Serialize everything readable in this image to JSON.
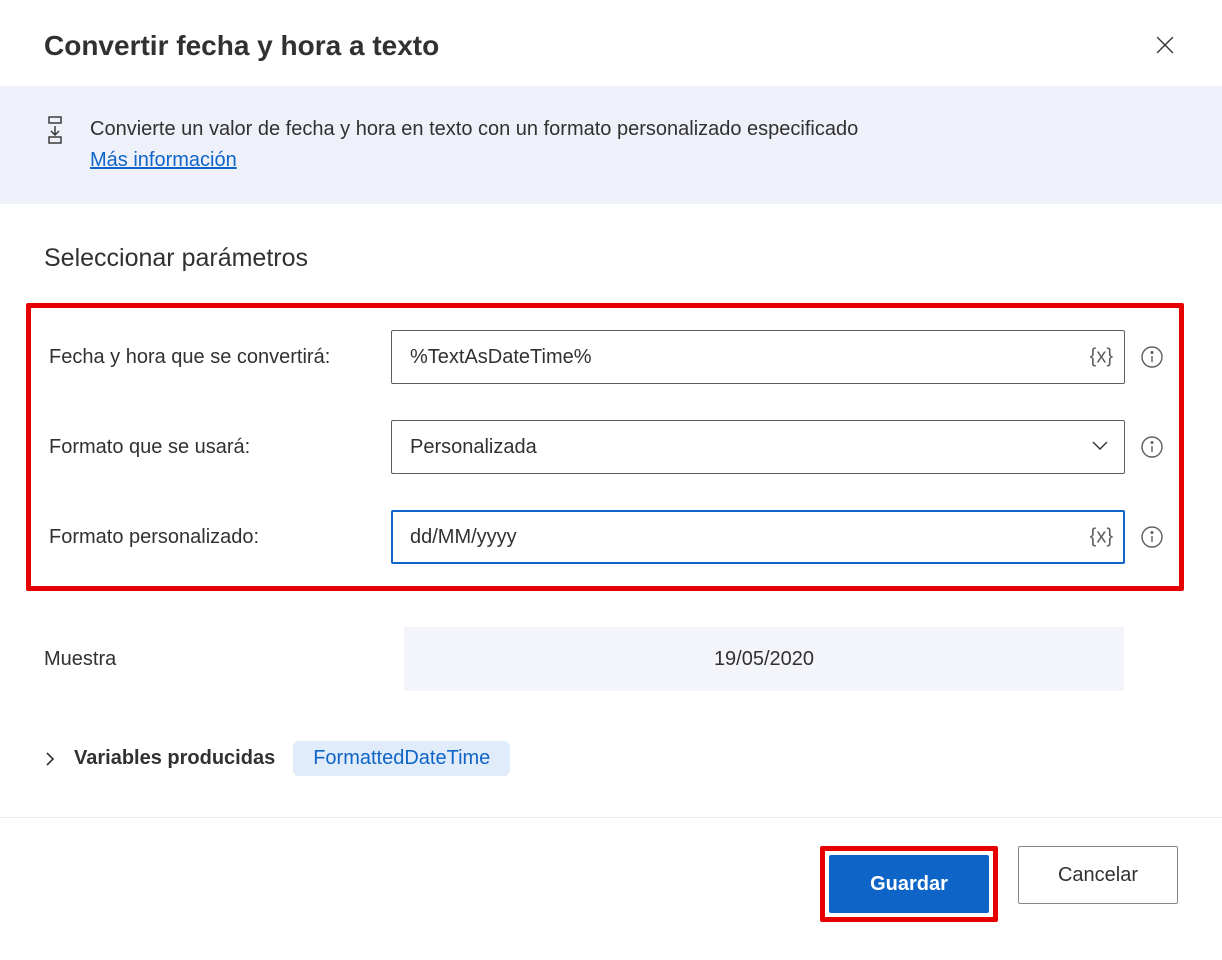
{
  "dialog": {
    "title": "Convertir fecha y hora a texto",
    "info_text": "Convierte un valor de fecha y hora en texto con un formato personalizado especificado",
    "info_link": "Más información"
  },
  "section": {
    "title": "Seleccionar parámetros"
  },
  "fields": {
    "datetime": {
      "label": "Fecha y hora que se convertirá:",
      "value": "%TextAsDateTime%",
      "var_badge": "{x}"
    },
    "format": {
      "label": "Formato que se usará:",
      "value": "Personalizada"
    },
    "custom_format": {
      "label": "Formato personalizado:",
      "value": "dd/MM/yyyy",
      "var_badge": "{x}"
    },
    "sample": {
      "label": "Muestra",
      "value": "19/05/2020"
    }
  },
  "variables": {
    "label": "Variables producidas",
    "output": "FormattedDateTime"
  },
  "buttons": {
    "save": "Guardar",
    "cancel": "Cancelar"
  }
}
